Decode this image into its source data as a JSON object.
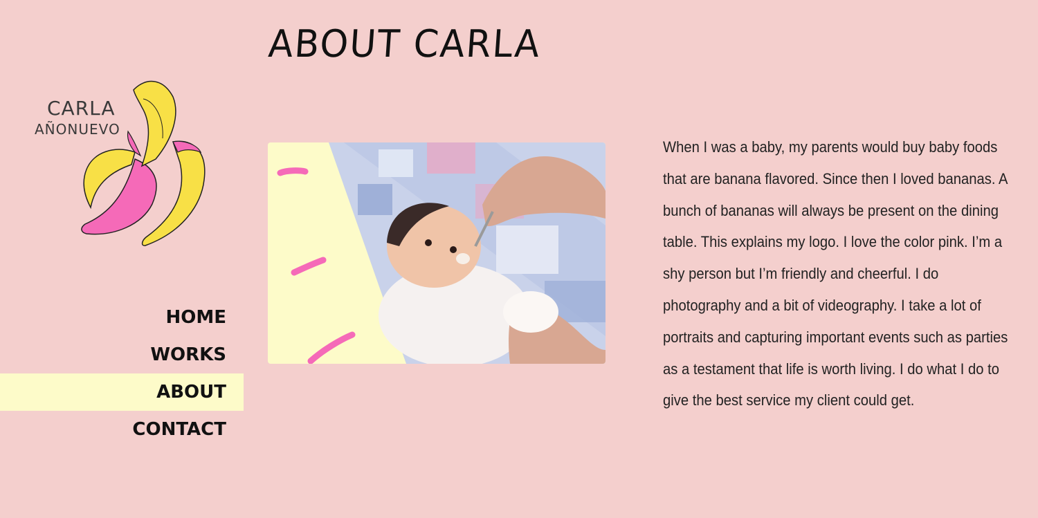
{
  "page": {
    "title": "ABOUT CARLA"
  },
  "logo": {
    "line1": "CARLA",
    "line2": "AÑONUEVO"
  },
  "nav": {
    "items": [
      {
        "label": "HOME"
      },
      {
        "label": "WORKS"
      },
      {
        "label": "ABOUT",
        "active": true
      },
      {
        "label": "CONTACT"
      }
    ]
  },
  "about": {
    "text": "When I was a baby, my parents would buy baby foods that are banana flavored. Since then I loved bananas. A bunch of bananas will always be present on the dining table. This explains my logo. I love the color pink. I’m a shy person but I’m friendly and cheerful. I do photography and a bit of videography. I take a lot of portraits and capturing important events such as parties as a testament that life is worth living. I do what I do to give the best service my client could get."
  },
  "colors": {
    "background": "#f4cfcd",
    "nav_active": "#fdfbc9",
    "banana_yellow": "#f8e046",
    "banana_pink": "#f56ab8"
  }
}
